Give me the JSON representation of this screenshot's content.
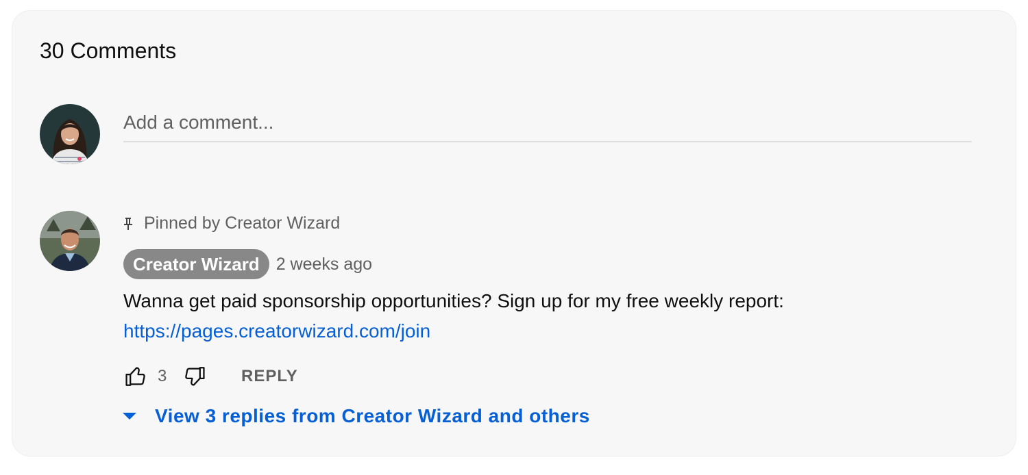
{
  "comments_header": {
    "count_label": "30 Comments"
  },
  "composer": {
    "placeholder": "Add a comment..."
  },
  "pinned_comment": {
    "pinned_label": "Pinned by Creator Wizard",
    "author": "Creator Wizard",
    "timestamp": "2 weeks ago",
    "text": "Wanna get paid sponsorship opportunities? Sign up for my free weekly report:",
    "link": "https://pages.creatorwizard.com/join",
    "like_count": "3",
    "reply_label": "REPLY",
    "view_replies_label": "View 3 replies from Creator Wizard and others"
  },
  "colors": {
    "link_blue": "#065fd4",
    "secondary_text": "#606060",
    "author_chip_bg": "#888888",
    "panel_bg": "#f7f7f7"
  },
  "icons": [
    "pin-icon",
    "thumbs-up-icon",
    "thumbs-down-icon",
    "caret-down-icon"
  ]
}
